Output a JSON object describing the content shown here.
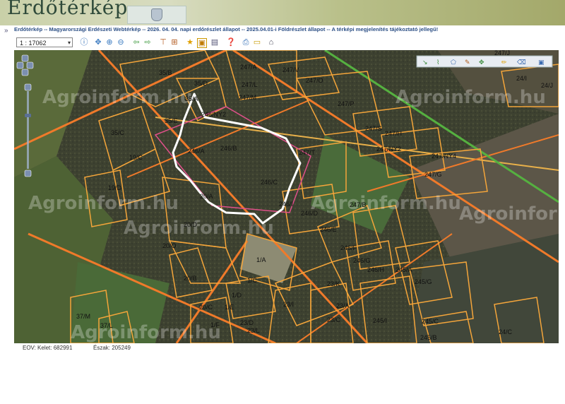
{
  "header": {
    "logo": "Erdőtérkép"
  },
  "title": "Erdőtérkép -- Magyarországi Erdészeti Webtérkép -- 2026. 04. 04. napi erdőrészlet állapot -- 2025.04.01-i Földrészlet állapot -- A térképi megjelenítés tájékoztató jellegű!",
  "toolbar": {
    "scale": "1 : 17062"
  },
  "watermark": "Agroinform.hu",
  "status": {
    "kelet": "EOV: Kelet: 682991",
    "eszak": "Észak: 205249"
  },
  "parcel_labels": [
    "35/B",
    "35/D",
    "35/A",
    "35/E",
    "35/C",
    "19/C",
    "19/D",
    "20/A",
    "20/D",
    "20/O",
    "20/B",
    "20/C",
    "1/A",
    "1/C",
    "1/D",
    "1/E",
    "1/F",
    "37/M",
    "37/L",
    "23/D",
    "23/L",
    "23/I",
    "23/A",
    "23/C",
    "23/K",
    "246/NY2",
    "246/A",
    "246/B",
    "246/C",
    "246/I",
    "246/D",
    "246/E",
    "246/F",
    "246/G",
    "246/H",
    "247/A",
    "247/L",
    "247/M",
    "247/V",
    "247/O",
    "247/P",
    "247/S",
    "247/H",
    "247/NY2",
    "247/T",
    "247/NY4",
    "247/G",
    "247/B",
    "247/J",
    "245/A",
    "245/G",
    "245/I",
    "245/C",
    "245/B",
    "24/I",
    "24/J",
    "24/C"
  ]
}
